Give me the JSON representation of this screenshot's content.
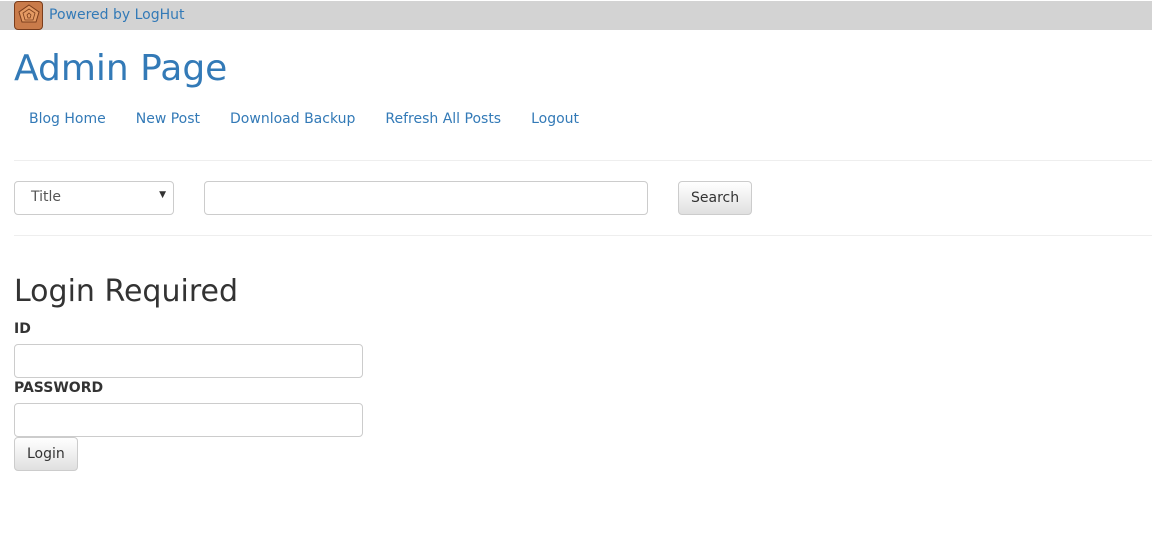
{
  "header": {
    "logo_text": "LogHut",
    "powered_label": "Powered by LogHut"
  },
  "page_title": "Admin Page",
  "nav": [
    "Blog Home",
    "New Post",
    "Download Backup",
    "Refresh All Posts",
    "Logout"
  ],
  "search": {
    "field_select": "Title",
    "query": "",
    "button": "Search"
  },
  "login": {
    "title": "Login Required",
    "id_label": "ID",
    "id_value": "",
    "password_label": "PASSWORD",
    "password_value": "",
    "button": "Login"
  },
  "colors": {
    "link": "#337ab7",
    "topbar": "#d3d3d3"
  }
}
